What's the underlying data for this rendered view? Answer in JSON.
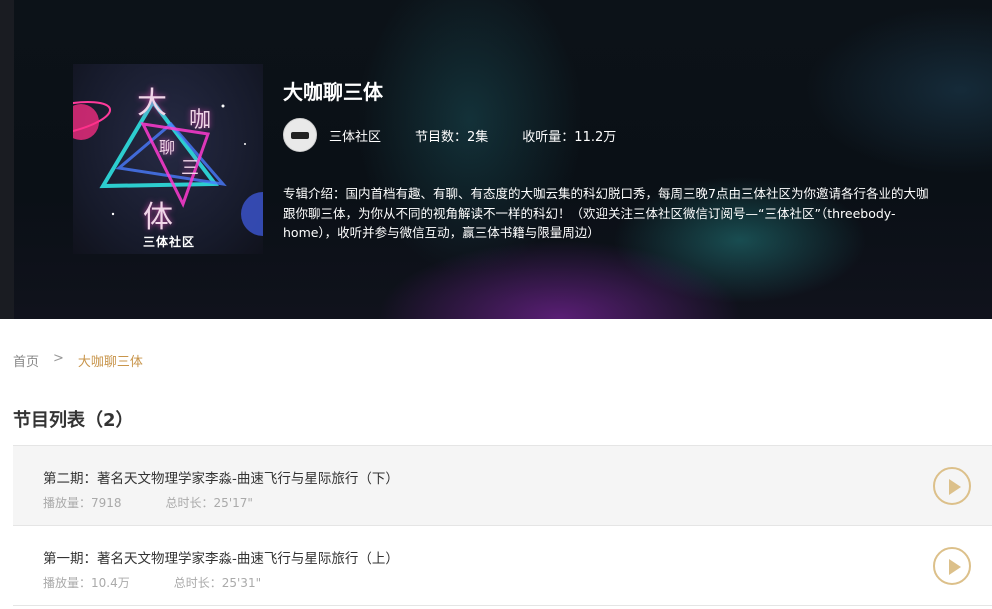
{
  "album": {
    "title": "大咖聊三体",
    "author": "三体社区",
    "episode_count": "节目数：2集",
    "listen_count": "收听量：11.2万",
    "intro": "专辑介绍：国内首档有趣、有聊、有态度的大咖云集的科幻脱口秀，每周三晚7点由三体社区为你邀请各行各业的大咖跟你聊三体，为你从不同的视角解读不一样的科幻！（欢迎关注三体社区微信订阅号—“三体社区”（threebody-home），收听并参与微信互动，赢三体书籍与限量周边）",
    "cover": {
      "chars": [
        "大",
        "咖",
        "聊",
        "三",
        "体"
      ],
      "brand": "三体社区"
    }
  },
  "breadcrumb": {
    "home": "首页",
    "separator": ">",
    "current": "大咖聊三体"
  },
  "list_heading": "节目列表（2）",
  "episodes": [
    {
      "title": "第二期：著名天文物理学家李淼-曲速飞行与星际旅行（下）",
      "plays": "播放量：7918",
      "duration": "总时长：25'17\""
    },
    {
      "title": "第一期：著名天文物理学家李淼-曲速飞行与星际旅行（上）",
      "plays": "播放量：10.4万",
      "duration": "总时长：25'31\""
    }
  ],
  "colors": {
    "accent": "#c8954b",
    "play_button": "#dcc08a",
    "hero_background": "#0c1218"
  },
  "icons": {
    "play": "play-circle-icon",
    "avatar": "author-avatar"
  }
}
